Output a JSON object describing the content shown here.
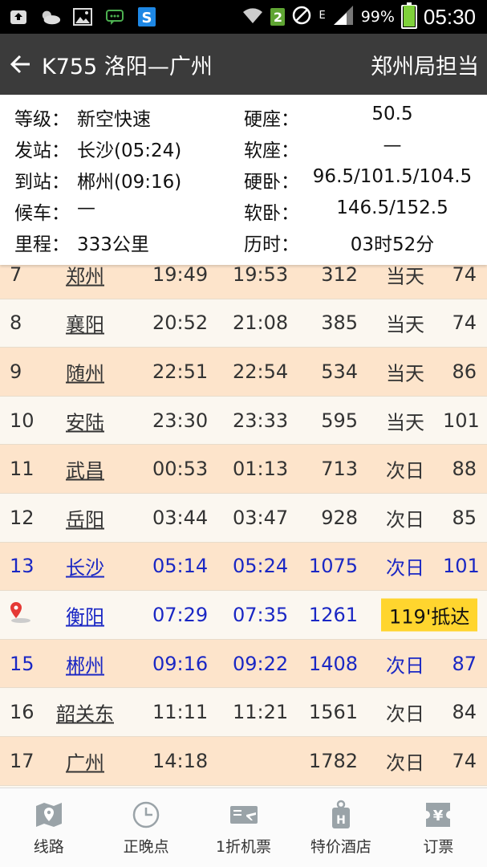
{
  "status_bar": {
    "signal_label": "E",
    "sim_badge": "2",
    "battery": "99%",
    "battery_level": 0.99,
    "time": "05:30"
  },
  "action_bar": {
    "title": "K755 洛阳—广州",
    "bureau": "郑州局担当"
  },
  "info": {
    "rows": [
      {
        "k": "等级：",
        "v": "新空快速",
        "rk": "硬座：",
        "rv": "50.5"
      },
      {
        "k": "发站：",
        "v": "长沙(05:24)",
        "rk": "软座：",
        "rv": "—"
      },
      {
        "k": "到站：",
        "v": "郴州(09:16)",
        "rk": "硬卧：",
        "rv": "96.5/101.5/104.5"
      },
      {
        "k": "候车：",
        "v": "—",
        "rk": "软卧：",
        "rv": "146.5/152.5"
      },
      {
        "k": "里程：",
        "v": "333公里",
        "rk": "历时：",
        "rv": "03时52分"
      }
    ]
  },
  "stops": [
    {
      "no": "7",
      "station": "郑州",
      "arr": "19:49",
      "dep": "19:53",
      "km": "312",
      "day": "当天",
      "speed": "74"
    },
    {
      "no": "8",
      "station": "襄阳",
      "arr": "20:52",
      "dep": "21:08",
      "km": "385",
      "day": "当天",
      "speed": "74"
    },
    {
      "no": "9",
      "station": "随州",
      "arr": "22:51",
      "dep": "22:54",
      "km": "534",
      "day": "当天",
      "speed": "86"
    },
    {
      "no": "10",
      "station": "安陆",
      "arr": "23:30",
      "dep": "23:33",
      "km": "595",
      "day": "当天",
      "speed": "101"
    },
    {
      "no": "11",
      "station": "武昌",
      "arr": "00:53",
      "dep": "01:13",
      "km": "713",
      "day": "次日",
      "speed": "88"
    },
    {
      "no": "12",
      "station": "岳阳",
      "arr": "03:44",
      "dep": "03:47",
      "km": "928",
      "day": "次日",
      "speed": "85"
    },
    {
      "no": "13",
      "station": "长沙",
      "arr": "05:14",
      "dep": "05:24",
      "km": "1075",
      "day": "次日",
      "speed": "101"
    },
    {
      "no": "",
      "station": "衡阳",
      "arr": "07:29",
      "dep": "07:35",
      "km": "1261",
      "tag": "119'抵达"
    },
    {
      "no": "15",
      "station": "郴州",
      "arr": "09:16",
      "dep": "09:22",
      "km": "1408",
      "day": "次日",
      "speed": "87"
    },
    {
      "no": "16",
      "station": "韶关东",
      "arr": "11:11",
      "dep": "11:21",
      "km": "1561",
      "day": "次日",
      "speed": "84"
    },
    {
      "no": "17",
      "station": "广州",
      "arr": "14:18",
      "dep": "",
      "km": "1782",
      "day": "次日",
      "speed": "74"
    }
  ],
  "highlight": {
    "color": "#1a27c4",
    "tag_color": "#ffd52e",
    "odd_row_color": "#fde4cb"
  },
  "bottom_nav": [
    {
      "label": "线路",
      "icon": "map-icon"
    },
    {
      "label": "正晚点",
      "icon": "clock-icon"
    },
    {
      "label": "1折机票",
      "icon": "flight-ticket-icon"
    },
    {
      "label": "特价酒店",
      "icon": "hotel-icon"
    },
    {
      "label": "订票",
      "icon": "ticket-yen-icon"
    }
  ]
}
